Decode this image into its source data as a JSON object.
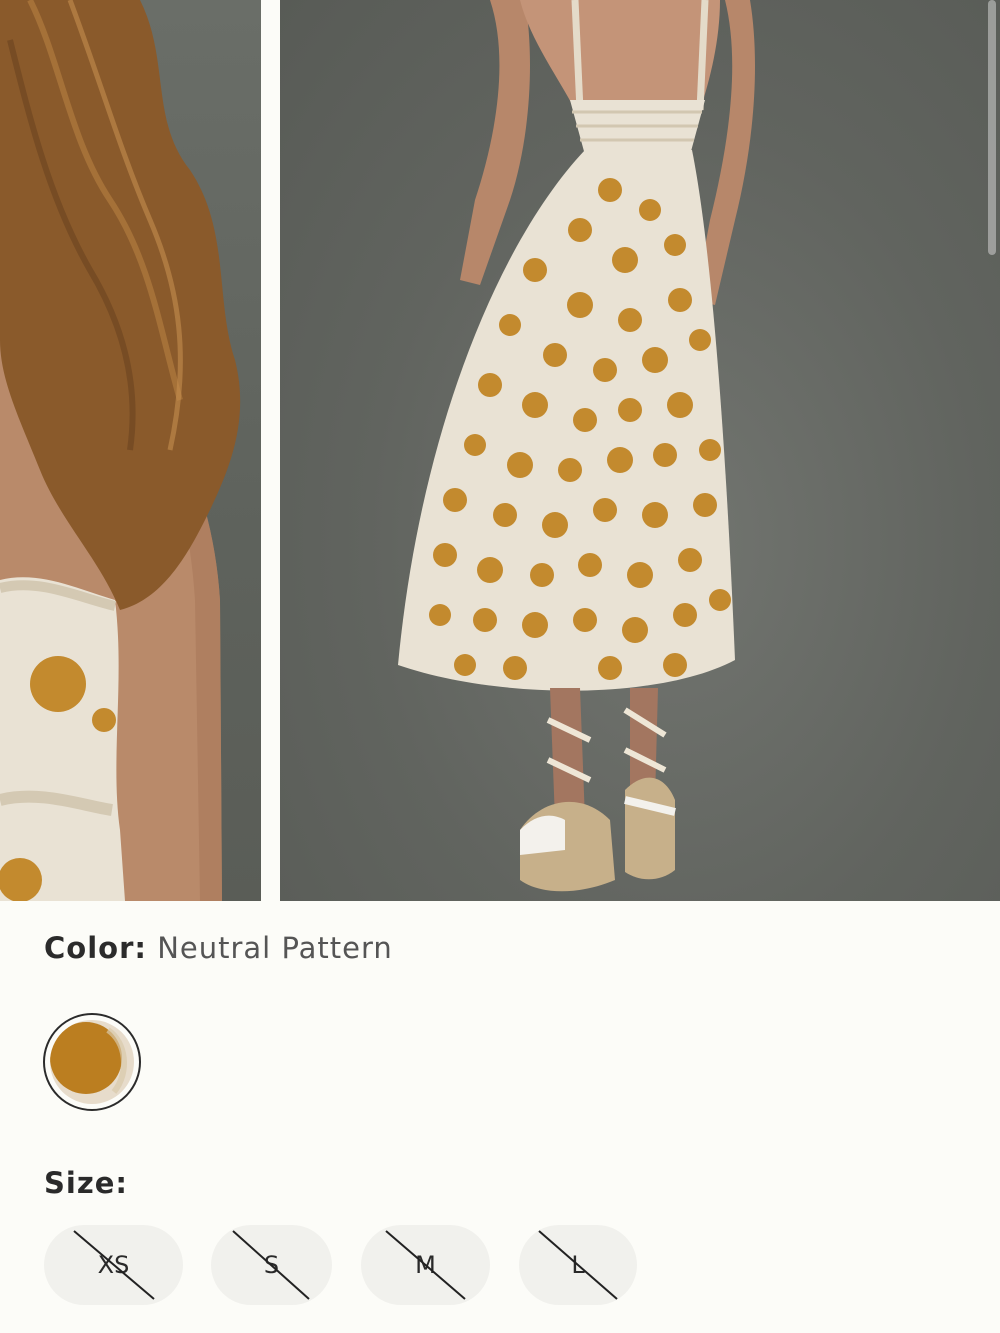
{
  "color": {
    "label": "Color:",
    "value": "Neutral Pattern",
    "swatch": {
      "base": "#bb7e20",
      "accent": "#e7dccb",
      "name": "neutral-pattern-swatch"
    }
  },
  "size": {
    "label": "Size:",
    "options": [
      {
        "label": "XS",
        "available": false
      },
      {
        "label": "S",
        "available": false
      },
      {
        "label": "M",
        "available": false
      },
      {
        "label": "L",
        "available": false
      }
    ]
  },
  "palette": {
    "dress": "#e9e2d4",
    "dots": "#c38a2e",
    "hair": "#8a5a2b",
    "skin": "#b8896a",
    "backdrop": "#63665f"
  }
}
